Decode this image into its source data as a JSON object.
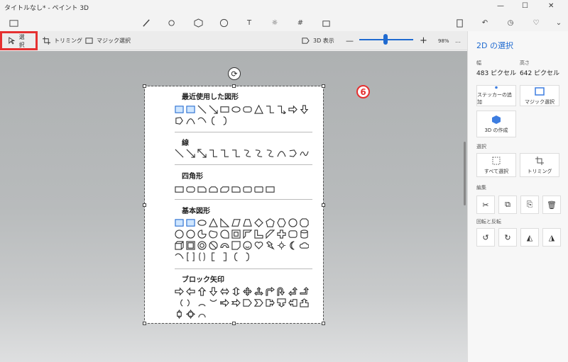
{
  "window": {
    "title": "タイトルなし* - ペイント 3D"
  },
  "subbar": {
    "select_label": "選択",
    "trim_label": "トリミング",
    "magic_label": "マジック選択",
    "view3d_label": "3D 表示",
    "zoom": "98%",
    "more": "…",
    "zoom_minus": "—",
    "zoom_plus": "+"
  },
  "canvas": {
    "step_badge": "6",
    "sections": [
      {
        "title": "最近使用した図形"
      },
      {
        "title": "線"
      },
      {
        "title": "四角形"
      },
      {
        "title": "基本図形"
      },
      {
        "title": "ブロック矢印"
      }
    ]
  },
  "panel": {
    "title": "2D の選択",
    "width_label": "幅",
    "width_value": "483 ピクセル",
    "height_label": "高さ",
    "height_value": "642 ピクセル",
    "sticker_label": "ステッカーの追加",
    "magic_label": "マジック選択",
    "make3d_label": "3D の作成",
    "select_section": "選択",
    "select_all_label": "すべて選択",
    "trim_label": "トリミング",
    "edit_section": "編集",
    "rotate_section": "回転と反転"
  },
  "colors": {
    "accent": "#1f6ad0",
    "highlight": "#e53030"
  }
}
